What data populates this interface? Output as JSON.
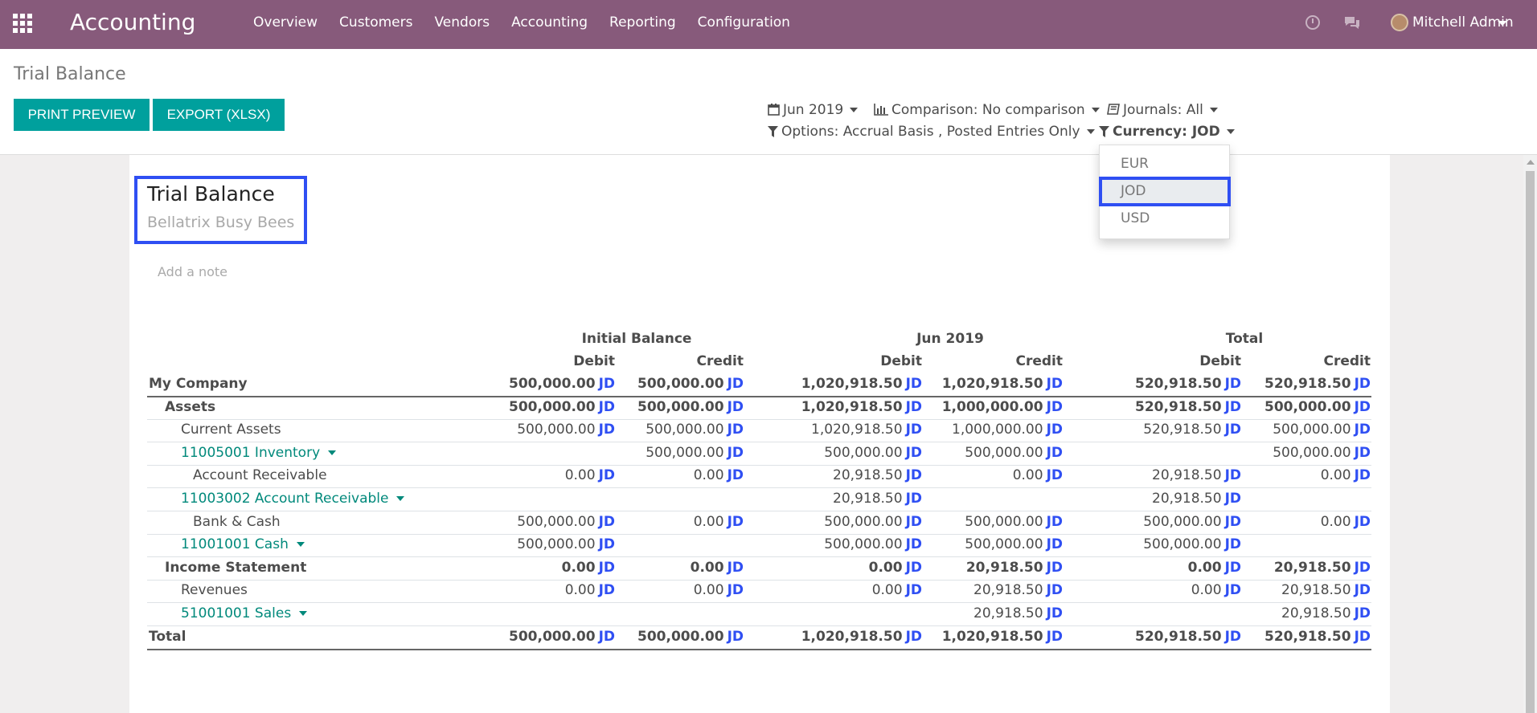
{
  "navbar": {
    "app_title": "Accounting",
    "menu": [
      "Overview",
      "Customers",
      "Vendors",
      "Accounting",
      "Reporting",
      "Configuration"
    ],
    "user_name": "Mitchell Admin",
    "icons": [
      "apps-grid-icon",
      "clock-icon",
      "chat-icon"
    ]
  },
  "control_panel": {
    "breadcrumb": "Trial Balance",
    "print_label": "PRINT PREVIEW",
    "export_label": "EXPORT (XLSX)",
    "period": "Jun 2019",
    "comparison": "Comparison: No comparison",
    "journals": "Journals: All",
    "options": "Options: Accrual Basis , Posted Entries Only",
    "currency": "Currency: JOD"
  },
  "currency_menu": {
    "options": [
      "EUR",
      "JOD",
      "USD"
    ],
    "selected": "JOD"
  },
  "report": {
    "title": "Trial Balance",
    "company": "Bellatrix Busy Bees",
    "add_note": "Add a note",
    "currency_symbol": "JD",
    "groups": [
      "Initial Balance",
      "Jun 2019",
      "Total"
    ],
    "columns": [
      "Debit",
      "Credit",
      "Debit",
      "Credit",
      "Debit",
      "Credit"
    ],
    "rows": [
      {
        "label": "My Company",
        "level": 0,
        "bold": true,
        "cells": [
          "500,000.00",
          "500,000.00",
          "1,020,918.50",
          "1,020,918.50",
          "520,918.50",
          "520,918.50"
        ]
      },
      {
        "label": "Assets",
        "level": 1,
        "bold": true,
        "cells": [
          "500,000.00",
          "500,000.00",
          "1,020,918.50",
          "1,000,000.00",
          "520,918.50",
          "500,000.00"
        ]
      },
      {
        "label": "Current Assets",
        "level": 2,
        "bold": false,
        "cells": [
          "500,000.00",
          "500,000.00",
          "1,020,918.50",
          "1,000,000.00",
          "520,918.50",
          "500,000.00"
        ]
      },
      {
        "label": "11005001 Inventory",
        "level": 2,
        "account": true,
        "cells": [
          "",
          "500,000.00",
          "500,000.00",
          "500,000.00",
          "",
          "500,000.00"
        ]
      },
      {
        "label": "Account Receivable",
        "level": 3,
        "bold": false,
        "cells": [
          "0.00",
          "0.00",
          "20,918.50",
          "0.00",
          "20,918.50",
          "0.00"
        ]
      },
      {
        "label": "11003002 Account Receivable",
        "level": 2,
        "account": true,
        "cells": [
          "",
          "",
          "20,918.50",
          "",
          "20,918.50",
          ""
        ]
      },
      {
        "label": "Bank & Cash",
        "level": 3,
        "bold": false,
        "cells": [
          "500,000.00",
          "0.00",
          "500,000.00",
          "500,000.00",
          "500,000.00",
          "0.00"
        ]
      },
      {
        "label": "11001001 Cash",
        "level": 2,
        "account": true,
        "cells": [
          "500,000.00",
          "",
          "500,000.00",
          "500,000.00",
          "500,000.00",
          ""
        ]
      },
      {
        "label": "Income Statement",
        "level": 1,
        "bold": true,
        "cells": [
          "0.00",
          "0.00",
          "0.00",
          "20,918.50",
          "0.00",
          "20,918.50"
        ]
      },
      {
        "label": "Revenues",
        "level": 2,
        "bold": false,
        "cells": [
          "0.00",
          "0.00",
          "0.00",
          "20,918.50",
          "0.00",
          "20,918.50"
        ]
      },
      {
        "label": "51001001 Sales",
        "level": 2,
        "account": true,
        "cells": [
          "",
          "",
          "",
          "20,918.50",
          "",
          "20,918.50"
        ]
      },
      {
        "label": "Total",
        "level": 0,
        "bold": true,
        "cells": [
          "500,000.00",
          "500,000.00",
          "1,020,918.50",
          "1,020,918.50",
          "520,918.50",
          "520,918.50"
        ]
      }
    ]
  },
  "colors": {
    "navbar": "#875a7b",
    "button": "#00a09d",
    "account_link": "#00897b",
    "currency_symbol": "#2f4ff3",
    "highlight_border": "#2f4ff3"
  }
}
